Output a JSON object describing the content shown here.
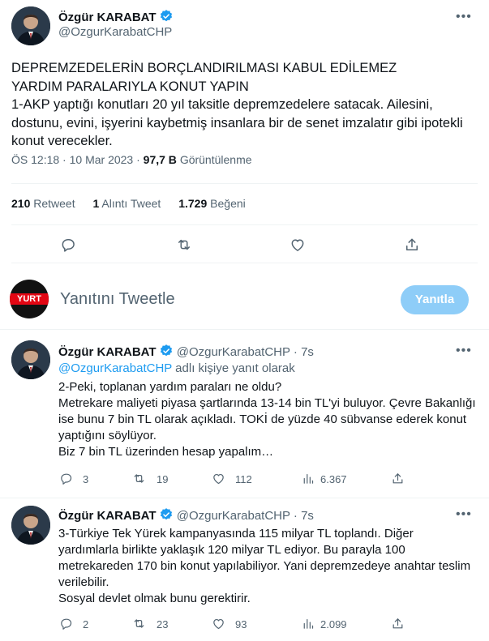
{
  "main_tweet": {
    "author_name": "Özgür KARABAT",
    "author_handle": "@OzgurKarabatCHP",
    "text": "DEPREMZEDELERİN BORÇLANDIRILMASI KABUL EDİLEMEZ\nYARDIM PARALARIYLA KONUT YAPIN\n1-AKP yaptığı konutları 20 yıl taksitle depremzedelere satacak. Ailesini, dostunu, evini, işyerini kaybetmiş insanlara bir de senet imzalatır gibi ipotekli konut verecekler.",
    "time": "ÖS 12:18",
    "date": "10 Mar 2023",
    "separator": "·",
    "views": "97,7 B",
    "views_label": "Görüntülenme",
    "retweets": "210",
    "retweets_label": "Retweet",
    "quotes": "1",
    "quotes_label": "Alıntı Tweet",
    "likes": "1.729",
    "likes_label": "Beğeni"
  },
  "compose": {
    "avatar_text": "YURT",
    "placeholder": "Yanıtını Tweetle",
    "button_label": "Yanıtla"
  },
  "replies": [
    {
      "author_name": "Özgür KARABAT",
      "author_handle": "@OzgurKarabatCHP",
      "time": "· 7s",
      "reply_to_mention": "@OzgurKarabatCHP",
      "reply_to_suffix": " adlı kişiye yanıt olarak",
      "text": "2-Peki, toplanan yardım paraları ne oldu?\nMetrekare maliyeti piyasa şartlarında 13-14 bin TL'yi buluyor. Çevre Bakanlığı ise bunu 7 bin TL olarak açıkladı. TOKİ de yüzde 40 sübvanse ederek konut yaptığını söylüyor.\nBiz 7 bin TL üzerinden hesap yapalım…",
      "replies": "3",
      "retweets": "19",
      "likes": "112",
      "views": "6.367"
    },
    {
      "author_name": "Özgür KARABAT",
      "author_handle": "@OzgurKarabatCHP",
      "time": "· 7s",
      "text": "3-Türkiye Tek Yürek kampanyasında 115 milyar TL toplandı. Diğer yardımlarla birlikte yaklaşık 120 milyar TL ediyor. Bu parayla 100 metrekareden 170 bin konut yapılabiliyor. Yani depremzedeye anahtar teslim verilebilir.\nSosyal devlet olmak bunu gerektirir.",
      "replies": "2",
      "retweets": "23",
      "likes": "93",
      "views": "2.099"
    }
  ],
  "colors": {
    "accent": "#1d9bf0",
    "reply_button": "#8ecdf8",
    "secondary_text": "#536471",
    "divider": "#eff3f4",
    "yurt_logo": "#e30613"
  }
}
